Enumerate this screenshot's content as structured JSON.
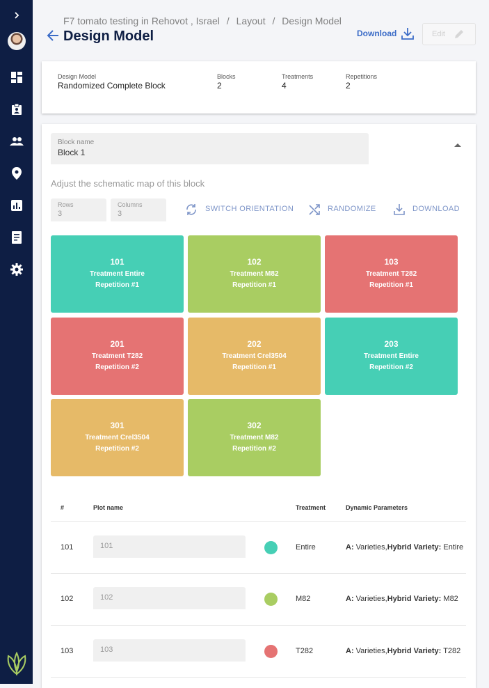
{
  "breadcrumb": {
    "items": [
      "F7 tomato testing in Rehovot , Israel",
      "/",
      "Layout",
      "/",
      "Design Model"
    ]
  },
  "page_title": "Design Model",
  "header": {
    "download_label": "Download",
    "edit_label": "Edit"
  },
  "summary": {
    "design_model_label": "Design Model",
    "design_model_value": "Randomized Complete Block",
    "blocks_label": "Blocks",
    "blocks_value": "2",
    "treatments_label": "Treatments",
    "treatments_value": "4",
    "repetitions_label": "Repetitions",
    "repetitions_value": "2"
  },
  "block": {
    "name_label": "Block name",
    "name_value": "Block 1"
  },
  "adjust_text": "Adjust the schematic map of this block",
  "grid_controls": {
    "rows_label": "Rows",
    "rows_value": "3",
    "columns_label": "Columns",
    "columns_value": "3",
    "switch_label": "SWITCH ORIENTATION",
    "randomize_label": "RANDOMIZE",
    "download_label": "DOWNLOAD"
  },
  "colors": {
    "teal": "#46cfb5",
    "green": "#a9cd62",
    "red": "#e57373",
    "orange": "#e6ba68",
    "navy": "#0e1e44",
    "link": "#3b6cc7"
  },
  "tiles": [
    {
      "number": "101",
      "treatment": "Treatment Entire",
      "repetition": "Repetition #1",
      "color": "#46cfb5"
    },
    {
      "number": "102",
      "treatment": "Treatment M82",
      "repetition": "Repetition #1",
      "color": "#a9cd62"
    },
    {
      "number": "103",
      "treatment": "Treatment T282",
      "repetition": "Repetition #1",
      "color": "#e57373"
    },
    {
      "number": "201",
      "treatment": "Treatment T282",
      "repetition": "Repetition #2",
      "color": "#e57373"
    },
    {
      "number": "202",
      "treatment": "Treatment Crel3504",
      "repetition": "Repetition #1",
      "color": "#e6ba68"
    },
    {
      "number": "203",
      "treatment": "Treatment Entire",
      "repetition": "Repetition #2",
      "color": "#46cfb5"
    },
    {
      "number": "301",
      "treatment": "Treatment Crel3504",
      "repetition": "Repetition #2",
      "color": "#e6ba68"
    },
    {
      "number": "302",
      "treatment": "Treatment M82",
      "repetition": "Repetition #2",
      "color": "#a9cd62"
    }
  ],
  "table": {
    "headers": {
      "num": "#",
      "plot_name": "Plot name",
      "treatment": "Treatment",
      "dynamic": "Dynamic Parameters"
    },
    "rows": [
      {
        "num": "101",
        "plot_name": "101",
        "color": "#46cfb5",
        "treatment": "Entire",
        "dyn_a": "A:",
        "dyn_a_val": " Varieties,",
        "dyn_hv": "Hybrid Variety:",
        "dyn_hv_val": " Entire"
      },
      {
        "num": "102",
        "plot_name": "102",
        "color": "#a9cd62",
        "treatment": "M82",
        "dyn_a": "A:",
        "dyn_a_val": " Varieties,",
        "dyn_hv": "Hybrid Variety:",
        "dyn_hv_val": " M82"
      },
      {
        "num": "103",
        "plot_name": "103",
        "color": "#e57373",
        "treatment": "T282",
        "dyn_a": "A:",
        "dyn_a_val": " Varieties,",
        "dyn_hv": "Hybrid Variety:",
        "dyn_hv_val": " T282"
      }
    ]
  }
}
